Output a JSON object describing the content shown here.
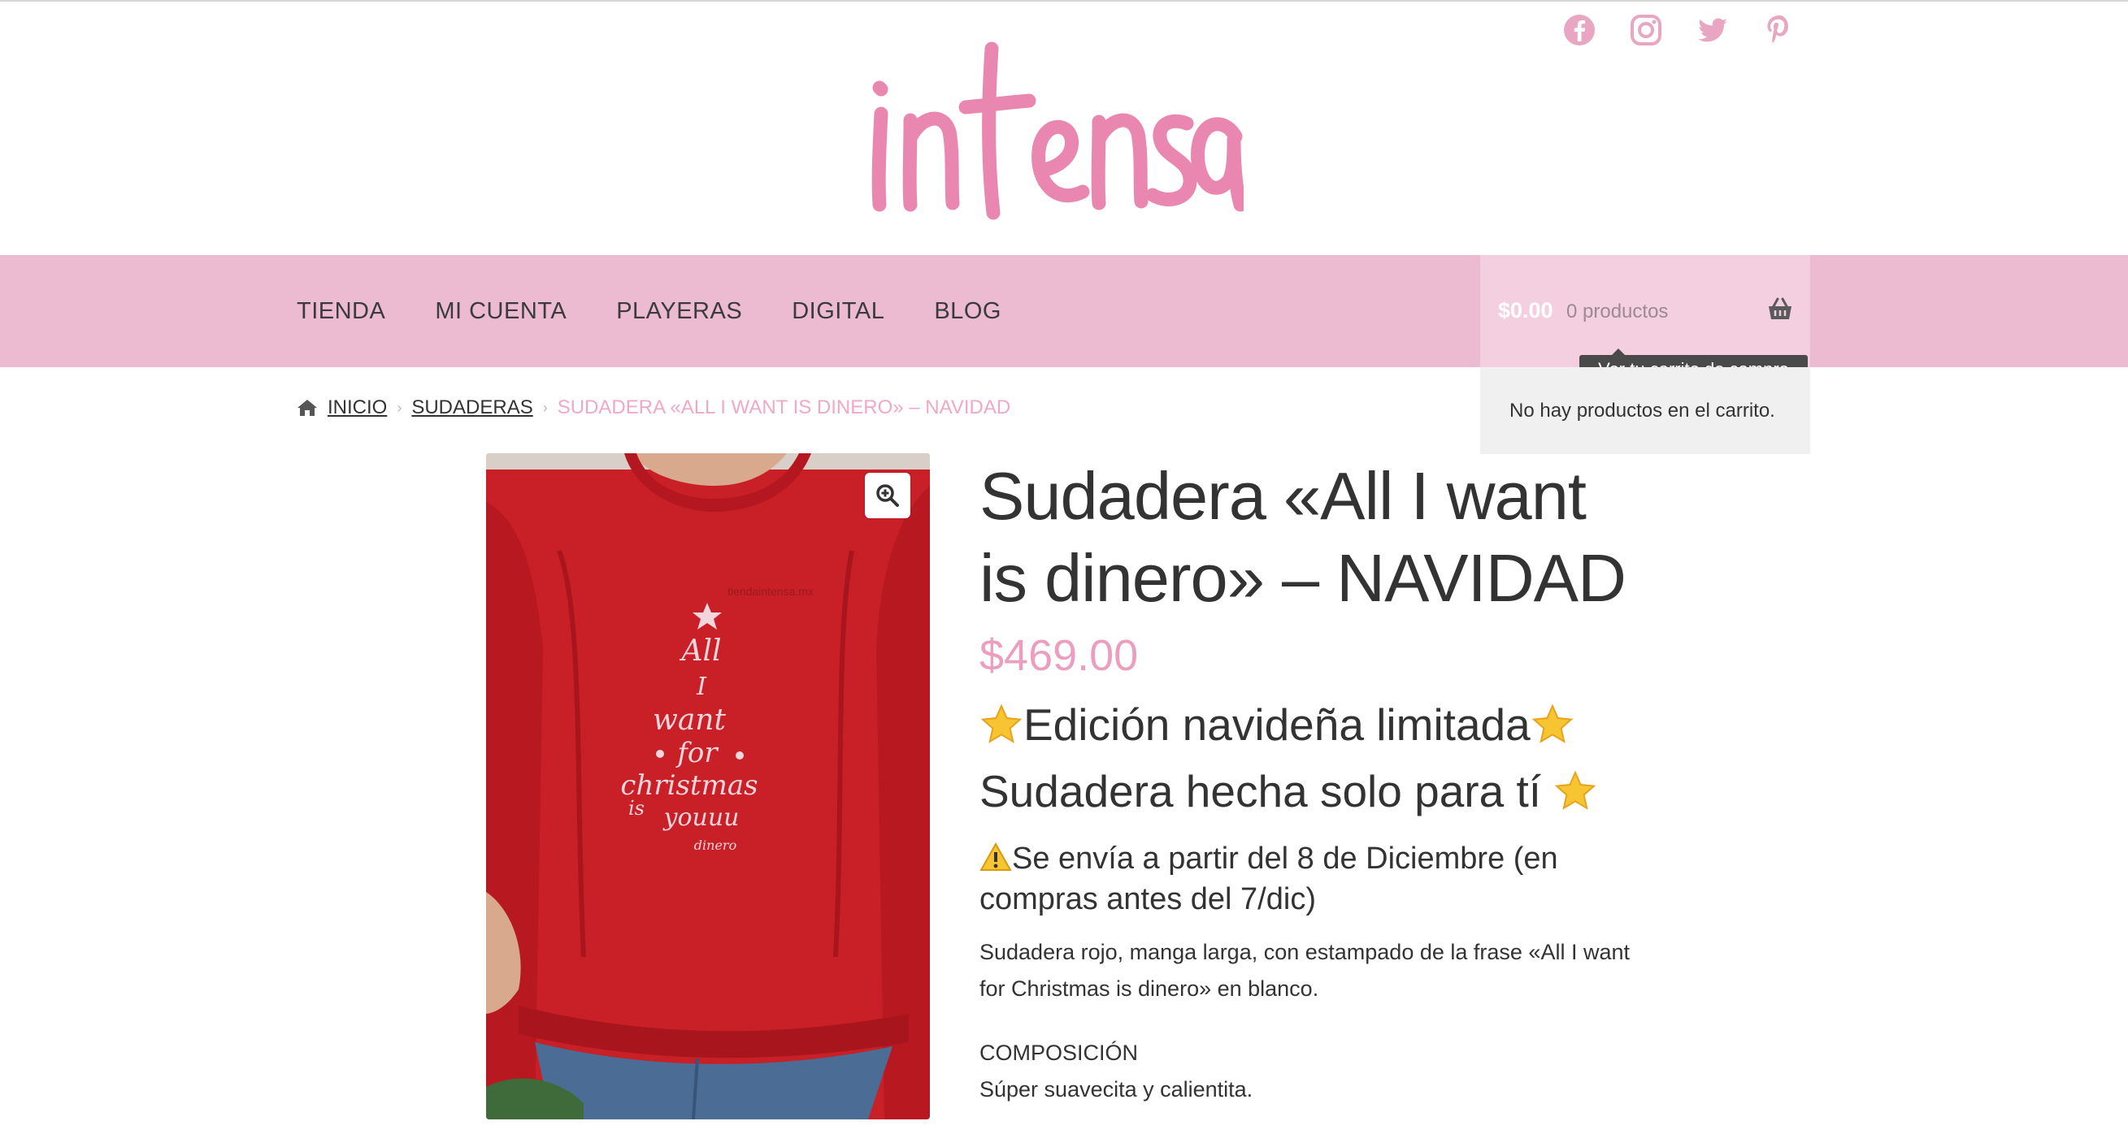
{
  "social": {
    "icons": [
      "facebook-icon",
      "instagram-icon",
      "twitter-icon",
      "pinterest-icon"
    ],
    "color": "#e9a6c3"
  },
  "brand": {
    "logo_text": "intensa",
    "logo_color": "#e987b0"
  },
  "nav": {
    "items": [
      {
        "label": "TIENDA"
      },
      {
        "label": "MI CUENTA"
      },
      {
        "label": "PLAYERAS"
      },
      {
        "label": "DIGITAL"
      },
      {
        "label": "BLOG"
      }
    ],
    "background": "#ecbbd2"
  },
  "cart": {
    "amount": "$0.00",
    "count": "0 productos",
    "tooltip": "Ver tu carrito de compra",
    "empty_message": "No hay productos en el carrito."
  },
  "breadcrumb": {
    "home": "INICIO",
    "category": "SUDADERAS",
    "current": "SUDADERA «ALL I WANT IS DINERO» – NAVIDAD"
  },
  "product": {
    "title": "Sudadera «All I want is dinero» – NAVIDAD",
    "price": "$469.00",
    "limited_edition": "Edición navideña limitada",
    "made_for_you": "Sudadera hecha solo para tí",
    "shipping_notice": "Se envía a partir del 8 de Diciembre (en compras antes del 7/dic)",
    "description": "Sudadera rojo, manga larga, con estampado de la frase «All I want for Christmas is dinero» en blanco.",
    "composition_heading": "COMPOSICIÓN",
    "composition_text": "Súper suavecita y calientita.",
    "image_print_words": [
      "All",
      "I",
      "want",
      "for",
      "christmas",
      "is",
      "youuu",
      "dinero"
    ],
    "image_watermark": "tiendaintensa.mx",
    "price_color": "#ec9ec0"
  }
}
